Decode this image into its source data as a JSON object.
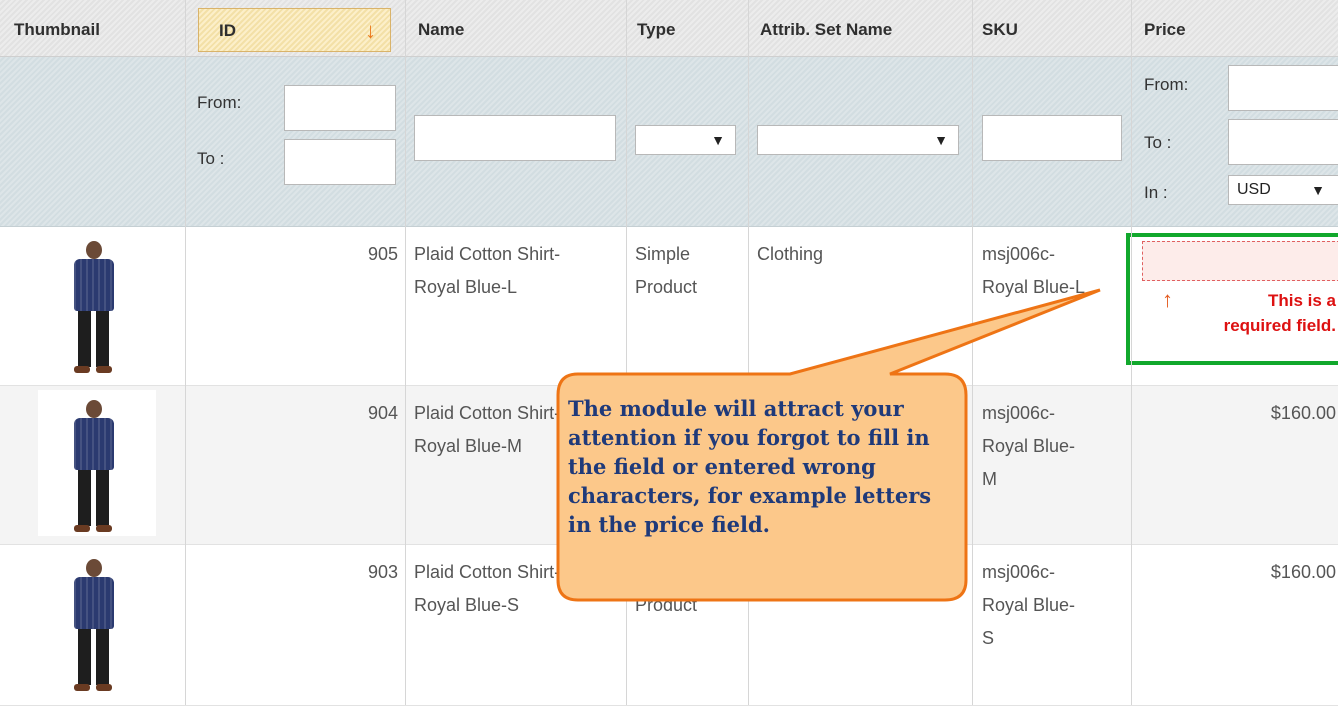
{
  "columns": {
    "thumbnail": "Thumbnail",
    "id": "ID",
    "name": "Name",
    "type": "Type",
    "attrib_set": "Attrib. Set Name",
    "sku": "SKU",
    "price": "Price"
  },
  "filters": {
    "id_from_label": "From:",
    "id_to_label": "To :",
    "price_from_label": "From:",
    "price_to_label": "To :",
    "price_in_label": "In :",
    "currency": "USD"
  },
  "rows": [
    {
      "id": "905",
      "name_line1": "Plaid Cotton Shirt-",
      "name_line2": "Royal Blue-L",
      "type_line1": "Simple",
      "type_line2": "Product",
      "attrib_set": "Clothing",
      "sku_line1": "msj006c-",
      "sku_line2": "Royal Blue-L",
      "sku_line3": "",
      "price": ""
    },
    {
      "id": "904",
      "name_line1": "Plaid Cotton Shirt-",
      "name_line2": "Royal Blue-M",
      "type_line1": "",
      "type_line2": "",
      "attrib_set": "",
      "sku_line1": "msj006c-",
      "sku_line2": "Royal Blue-",
      "sku_line3": "M",
      "price": "$160.00"
    },
    {
      "id": "903",
      "name_line1": "Plaid Cotton Shirt-",
      "name_line2": "Royal Blue-S",
      "type_line1": "",
      "type_line2": "Product",
      "attrib_set": "",
      "sku_line1": "msj006c-",
      "sku_line2": "Royal Blue-",
      "sku_line3": "S",
      "price": "$160.00"
    }
  ],
  "validation": {
    "message_line1": "This is a",
    "message_line2": "required field."
  },
  "callout": {
    "text": "The module will attract your attention if you forgot to fill in the field or entered wrong characters, for example letters in the price field."
  },
  "icons": {
    "sort": "sort-down-arrow-icon",
    "dropdown": "dropdown-triangle-icon",
    "error_arrow": "up-arrow-icon"
  },
  "colors": {
    "accent_orange": "#eb7a1d",
    "error_red": "#d11111",
    "highlight_green": "#11a82c",
    "callout_fill": "#fcc88a",
    "callout_text": "#1f3a7a"
  }
}
